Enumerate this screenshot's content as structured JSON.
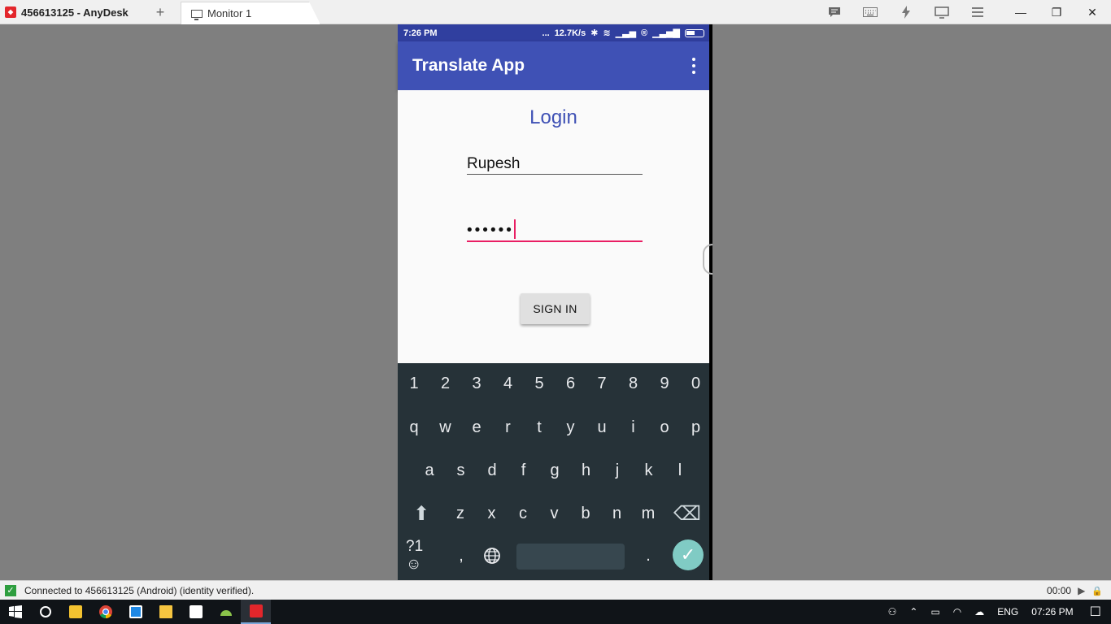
{
  "anydesk": {
    "app_tab": "456613125 - AnyDesk",
    "new_tab": "+",
    "monitor_tab": "Monitor 1",
    "toolbar_icons": [
      "chat-icon",
      "keyboard-icon",
      "actions-icon",
      "display-icon",
      "menu-icon"
    ],
    "window_controls": {
      "minimize": "—",
      "restore": "❐",
      "close": "✕"
    }
  },
  "phone": {
    "status": {
      "time": "7:26 PM",
      "dots": "...",
      "speed": "12.7K/s",
      "bt": "✱",
      "wifi": "≋",
      "sig1": "▁▃▅",
      "r": "®",
      "sig2": "▁▃▅▇"
    },
    "appbar_title": "Translate App",
    "login_title": "Login",
    "username_value": "Rupesh",
    "password_value": "••••••",
    "signin_label": "SIGN IN",
    "keyboard": {
      "row1": [
        "1",
        "2",
        "3",
        "4",
        "5",
        "6",
        "7",
        "8",
        "9",
        "0"
      ],
      "row2": [
        "q",
        "w",
        "e",
        "r",
        "t",
        "y",
        "u",
        "i",
        "o",
        "p"
      ],
      "row3": [
        "a",
        "s",
        "d",
        "f",
        "g",
        "h",
        "j",
        "k",
        "l"
      ],
      "row4": [
        "z",
        "x",
        "c",
        "v",
        "b",
        "n",
        "m"
      ],
      "shift": "⬆",
      "backspace": "⌫",
      "symbols": "?1☺",
      "comma": ",",
      "globe": "🌐",
      "period": ".",
      "enter": "✓"
    }
  },
  "connection": {
    "status_text": "Connected to 456613125 (Android) (identity verified).",
    "timer": "00:00",
    "play": "▶",
    "lock": "🔒"
  },
  "taskbar": {
    "start": "⊞",
    "search": "◯",
    "store": "🛍",
    "chrome": "◉",
    "studio": "◧",
    "explorer": "📁",
    "notes": "◩",
    "android": "▲",
    "anydesk": "◆",
    "tray": {
      "people": "⚇",
      "chevron": "⌃",
      "battery": "▭",
      "wifi": "◠",
      "cloud": "☁",
      "language": "ENG",
      "time": "07:26 PM",
      "notifications": "☐"
    }
  }
}
